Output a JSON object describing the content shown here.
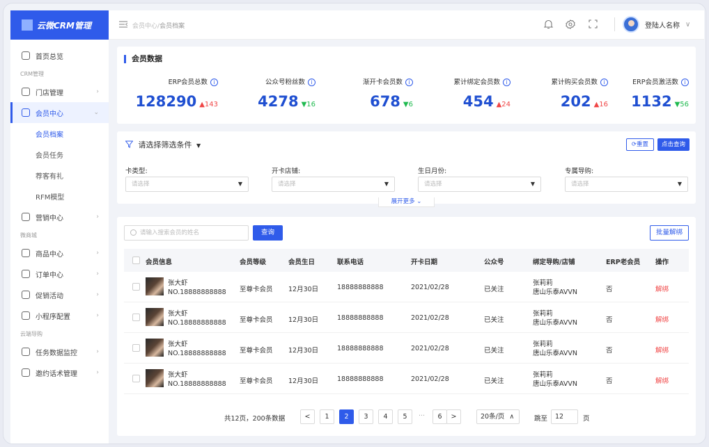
{
  "app": {
    "title": "云微CRM管理"
  },
  "sidebar": {
    "items": [
      {
        "type": "item",
        "label": "首页总览",
        "icon": "home-icon"
      },
      {
        "type": "group",
        "label": "CRM管理"
      },
      {
        "type": "item",
        "label": "门店管理",
        "icon": "store-icon",
        "chevron": "›"
      },
      {
        "type": "item",
        "label": "会员中心",
        "icon": "crown-icon",
        "chevron": "⌄",
        "active": true
      },
      {
        "type": "sub",
        "label": "会员档案",
        "active": true
      },
      {
        "type": "sub",
        "label": "会员任务"
      },
      {
        "type": "sub",
        "label": "荐客有礼"
      },
      {
        "type": "sub",
        "label": "RFM模型"
      },
      {
        "type": "item",
        "label": "营销中心",
        "icon": "target-icon",
        "chevron": "›"
      },
      {
        "type": "group",
        "label": "微商城"
      },
      {
        "type": "item",
        "label": "商品中心",
        "icon": "goods-icon",
        "chevron": "›"
      },
      {
        "type": "item",
        "label": "订单中心",
        "icon": "order-icon",
        "chevron": "›"
      },
      {
        "type": "item",
        "label": "促销活动",
        "icon": "promo-icon",
        "chevron": "›"
      },
      {
        "type": "item",
        "label": "小程序配置",
        "icon": "miniapp-icon",
        "chevron": "›"
      },
      {
        "type": "group",
        "label": "云端导购"
      },
      {
        "type": "item",
        "label": "任务数据监控",
        "icon": "monitor-icon",
        "chevron": "›"
      },
      {
        "type": "item",
        "label": "邀约话术管理",
        "icon": "chat-icon",
        "chevron": "›"
      }
    ]
  },
  "header": {
    "breadcrumb_parent": "会员中心",
    "breadcrumb_sep": "/",
    "breadcrumb_current": "会员档案",
    "icons": [
      "bell-icon",
      "settings-icon",
      "fullscreen-icon"
    ],
    "user_name": "登陆人名称",
    "user_chevron": "∨"
  },
  "stats": {
    "title": "会员数据",
    "info_glyph": "i",
    "items": [
      {
        "label": "ERP会员总数",
        "value": "128290",
        "delta": "143",
        "dir": "up",
        "arrow": "▲"
      },
      {
        "label": "公众号粉丝数",
        "value": "4278",
        "delta": "16",
        "dir": "down",
        "arrow": "▼"
      },
      {
        "label": "渐开卡会员数",
        "value": "678",
        "delta": "6",
        "dir": "down",
        "arrow": "▼"
      },
      {
        "label": "累计绑定会员数",
        "value": "454",
        "delta": "24",
        "dir": "up",
        "arrow": "▲"
      },
      {
        "label": "累计购买会员数",
        "value": "202",
        "delta": "16",
        "dir": "up",
        "arrow": "▲"
      },
      {
        "label": "ERP会员激活数",
        "value": "1132",
        "delta": "56",
        "dir": "down",
        "arrow": "▼"
      }
    ]
  },
  "filter": {
    "title": "请选择筛选条件",
    "title_caret": "▼",
    "reset_label": "重置",
    "query_label": "点击查询",
    "fields": [
      {
        "label": "卡类型:",
        "placeholder": "请选择"
      },
      {
        "label": "开卡店铺:",
        "placeholder": "请选择"
      },
      {
        "label": "生日月份:",
        "placeholder": "请选择"
      },
      {
        "label": "专属导购:",
        "placeholder": "请选择"
      }
    ],
    "select_arrow": "▼",
    "expand_label": "展开更多"
  },
  "table": {
    "search_placeholder": "请输入搜索会员的姓名",
    "search_button": "查询",
    "batch_button": "批量解绑",
    "columns": [
      "会员信息",
      "会员等级",
      "会员生日",
      "联系电话",
      "开卡日期",
      "公众号",
      "绑定导购/店铺",
      "ERP老会员",
      "操作"
    ],
    "rows": [
      {
        "name": "张大虾",
        "no": "NO.18888888888",
        "level": "至尊卡会员",
        "birthday": "12月30日",
        "phone": "18888888888",
        "date": "2021/02/28",
        "wechat": "已关注",
        "guide": "张莉莉",
        "store": "唐山乐泰AVVN",
        "erp": "否",
        "op": "解绑"
      },
      {
        "name": "张大虾",
        "no": "NO.18888888888",
        "level": "至尊卡会员",
        "birthday": "12月30日",
        "phone": "18888888888",
        "date": "2021/02/28",
        "wechat": "已关注",
        "guide": "张莉莉",
        "store": "唐山乐泰AVVN",
        "erp": "否",
        "op": "解绑"
      },
      {
        "name": "张大虾",
        "no": "NO.18888888888",
        "level": "至尊卡会员",
        "birthday": "12月30日",
        "phone": "18888888888",
        "date": "2021/02/28",
        "wechat": "已关注",
        "guide": "张莉莉",
        "store": "唐山乐泰AVVN",
        "erp": "否",
        "op": "解绑"
      },
      {
        "name": "张大虾",
        "no": "NO.18888888888",
        "level": "至尊卡会员",
        "birthday": "12月30日",
        "phone": "18888888888",
        "date": "2021/02/28",
        "wechat": "已关注",
        "guide": "张莉莉",
        "store": "唐山乐泰AVVN",
        "erp": "否",
        "op": "解绑"
      }
    ]
  },
  "pagination": {
    "summary": "共12页，200条数据",
    "prev": "<",
    "next": ">",
    "pages": [
      "1",
      "2",
      "3",
      "4",
      "5",
      "···",
      "6"
    ],
    "current": "2",
    "page_size": "20条/页",
    "page_size_arrow": "∧",
    "jump_label": "跳至",
    "jump_value": "12",
    "jump_suffix": "页"
  },
  "colors": {
    "primary": "#2f5bea",
    "up": "#f04646",
    "down": "#1fba4f"
  }
}
